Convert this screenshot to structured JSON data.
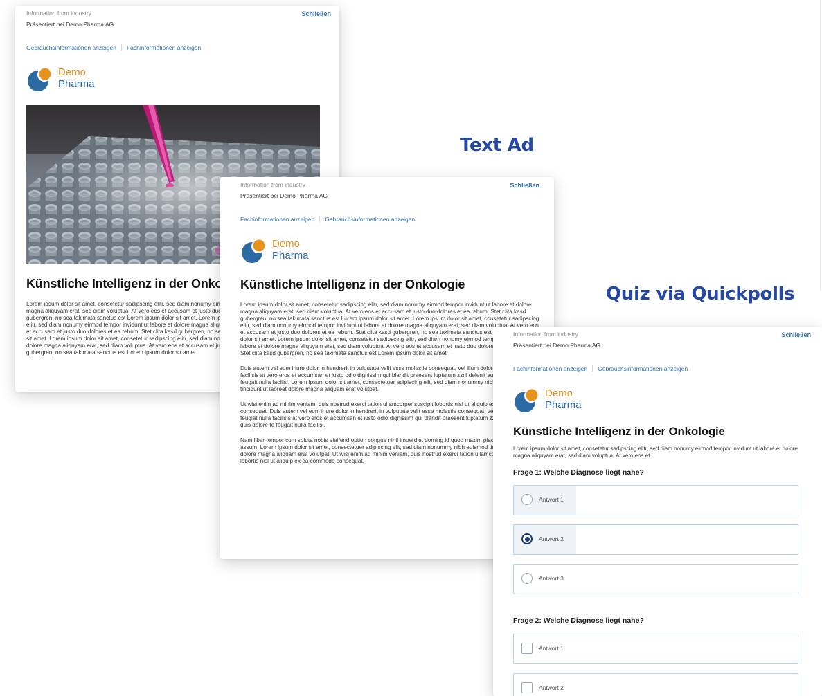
{
  "labels": {
    "text_ad": "Text Ad",
    "quiz": "Quiz via Quickpolls"
  },
  "card1": {
    "info_label": "Information from industry",
    "presented_by": "Präsentiert bei Demo Pharma AG",
    "close": "Schließen",
    "link_a": "Gebrauchsinformationen anzeigen",
    "link_b": "Fachinformationen anzeigen",
    "logo_line1": "Demo",
    "logo_line2": "Pharma",
    "title": "Künstliche Intelligenz in der Onkologie",
    "body": "Lorem ipsum dolor sit amet, consetetur sadipscing elitr, sed diam nonumy eirmod tempor invidunt ut labore et dolore magna aliquyam erat, sed diam voluptua. At vero eos et accusam et justo duo dolores et ea rebum. Stet clita kasd gubergren, no sea takimata sanctus est Lorem ipsum dolor sit amet. Lorem ipsum dolor sit amet, consetetur sadipscing elitr, sed diam nonumy eirmod tempor invidunt ut labore et dolore magna aliquyam erat, sed diam voluptua. At vero eos et accusam et justo duo dolores et ea rebum. Stet clita kasd gubergren, no sea takimata sanctus est Lorem ipsum dolor sit amet. Lorem ipsum dolor sit amet, consetetur sadipscing elitr, sed diam nonumy eirmod tempor invidunt ut labore et dolore magna aliquyam erat, sed diam voluptua. At vero eos et accusam et justo duo dolores et ea rebum. Stet clita kasd gubergren, no sea takimata sanctus est Lorem ipsum dolor sit amet."
  },
  "card2": {
    "info_label": "Information from industry",
    "presented_by": "Präsentiert bei Demo Pharma AG",
    "close": "Schließen",
    "link_a": "Fachinformationen anzeigen",
    "link_b": "Gebrauchsinformationen anzeigen",
    "logo_line1": "Demo",
    "logo_line2": "Pharma",
    "title": "Künstliche Intelligenz in der Onkologie",
    "p1": "Lorem ipsum dolor sit amet, consetetur sadipscing elitr, sed diam nonumy eirmod tempor invidunt ut labore et dolore magna aliquyam erat, sed diam voluptua. At vero eos et accusam et justo duo dolores et ea rebum. Stet clita kasd gubergren, no sea takimata sanctus est Lorem ipsum dolor sit amet. Lorem ipsum dolor sit amet, consetetur sadipscing elitr, sed diam nonumy eirmod tempor invidunt ut labore et dolore magna aliquyam erat, sed diam voluptua. At vero eos et accusam et justo duo dolores et ea rebum. Stet clita kasd gubergren, no sea takimata sanctus est Lorem ipsum dolor sit amet. Lorem ipsum dolor sit amet, consetetur sadipscing elitr, sed diam nonumy eirmod tempor invidunt ut labore et dolore magna aliquyam erat, sed diam voluptua. At vero eos et accusam et justo duo dolores et ea rebum. Stet clita kasd gubergren, no sea takimata sanctus est Lorem ipsum dolor sit amet.",
    "p2": "Duis autem vel eum iriure dolor in hendrerit in vulputate velit esse molestie consequat, vel illum dolore eu feugiat nulla facilisis at vero eros et accumsan et iusto odio dignissim qui blandit praesent luptatum zzril delenit augue duis dolore te feugait nulla facilisi. Lorem ipsum dolor sit amet, consectetuer adipiscing elit, sed diam nonummy nibh euismod tincidunt ut laoreet dolore magna aliquam erat volutpat.",
    "p3": "Ut wisi enim ad minim veniam, quis nostrud exerci tation ullamcorper suscipit lobortis nisl ut aliquip ex ea commodo consequat. Duis autem vel eum iriure dolor in hendrerit in vulputate velit esse molestie consequat, vel illum dolore eu feugiat nulla facilisis at vero eros et accumsan et iusto odio dignissim qui blandit praesent luptatum zzril delenit augue duis dolore te feugait nulla facilisi.",
    "p4": "Nam liber tempor cum soluta nobis eleifend option congue nihil imperdiet doming id quod mazim placerat facer possim assum. Lorem ipsum dolor sit amet, consectetuer adipiscing elit, sed diam nonummy nibh euismod tincidunt ut laoreet dolore magna aliquam erat volutpat. Ut wisi enim ad minim veniam, quis nostrud exerci tation ullamcorper suscipit lobortis nisl ut aliquip ex ea commodo consequat."
  },
  "card3": {
    "info_label": "Information from industry",
    "presented_by": "Präsentiert bei Demo Pharma AG",
    "close": "Schließen",
    "link_a": "Fachinformationen anzeigen",
    "link_b": "Gebrauchsinformationen anzeigen",
    "logo_line1": "Demo",
    "logo_line2": "Pharma",
    "title": "Künstliche Intelligenz in der Onkologie",
    "body": "Lorem ipsum dolor sit amet, consetetur sadipscing elitr, sed diam nonumy eirmod tempor invidunt ut labore et dolore magna aliquyam erat, sed diam voluptua. At vero eos et",
    "q1": {
      "title": "Frage 1: Welche Diagnose liegt nahe?",
      "answers": [
        "Antwort 1",
        "Antwort 2",
        "Antwort 3"
      ],
      "selected_index": 1
    },
    "q2": {
      "title": "Frage 2: Welche Diagnose liegt nahe?",
      "answers": [
        "Antwort 1",
        "Antwort 2"
      ]
    }
  },
  "colors": {
    "accent_blue": "#2548a3",
    "link_blue": "#2f6fa7",
    "logo_orange": "#e8921e",
    "logo_blue": "#2b6aa3",
    "radio_selected": "#173a72"
  }
}
